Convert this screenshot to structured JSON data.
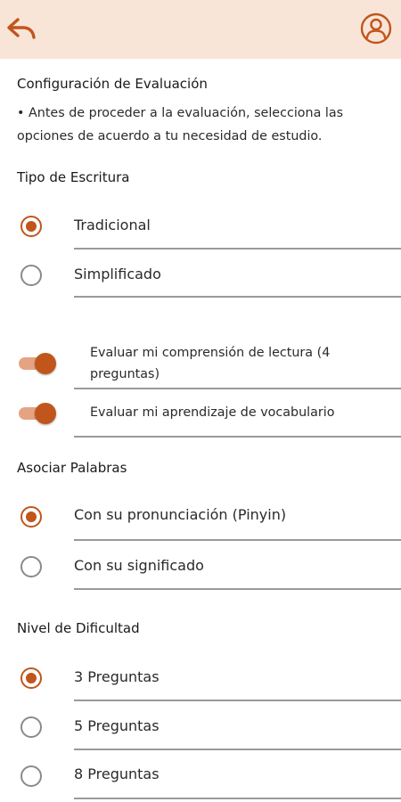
{
  "header": {
    "back_icon": "back-arrow-icon",
    "profile_icon": "user-profile-icon",
    "background": "#f9e5d8",
    "accent": "#c0561c"
  },
  "title": "Configuración de Evaluación",
  "intro": "• Antes de proceder a la evaluación, selecciona las opciones de acuerdo a tu necesidad de estudio.",
  "writing_type": {
    "title": "Tipo de Escritura",
    "options": [
      {
        "label": "Tradicional",
        "checked": true
      },
      {
        "label": "Simplificado",
        "checked": false
      }
    ]
  },
  "toggles": [
    {
      "label": "Evaluar mi comprensión de lectura (4 preguntas)",
      "on": true
    },
    {
      "label": "Evaluar mi aprendizaje de vocabulario",
      "on": true
    }
  ],
  "associate": {
    "title": "Asociar Palabras",
    "options": [
      {
        "label": "Con su pronunciación (Pinyin)",
        "checked": true
      },
      {
        "label": "Con su significado",
        "checked": false
      }
    ]
  },
  "difficulty": {
    "title": "Nivel de Dificultad",
    "options": [
      {
        "label": "3 Preguntas",
        "checked": true
      },
      {
        "label": "5 Preguntas",
        "checked": false
      },
      {
        "label": "8 Preguntas",
        "checked": false
      }
    ]
  }
}
